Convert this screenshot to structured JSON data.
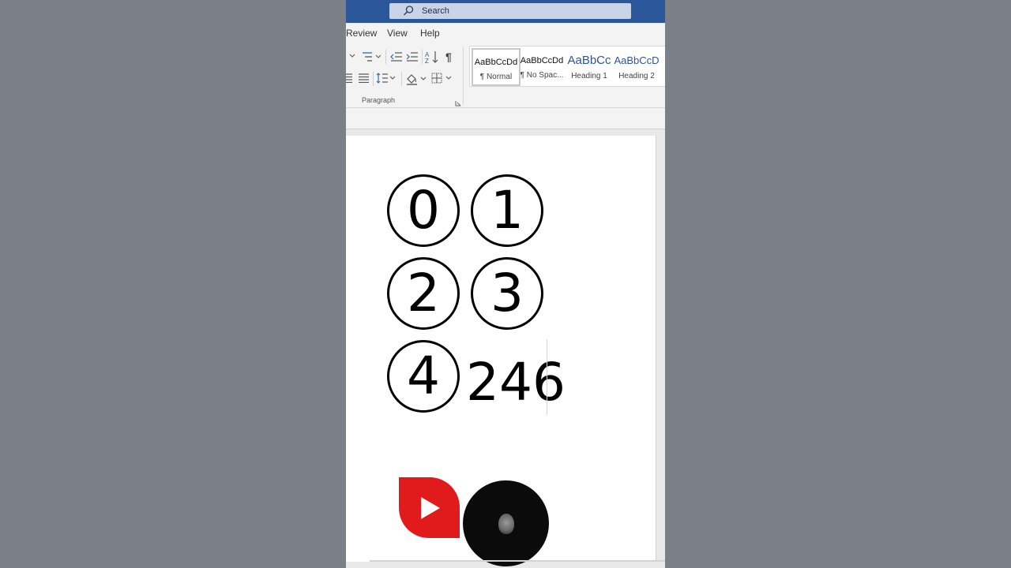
{
  "search": {
    "placeholder": "Search"
  },
  "tabs": [
    {
      "label": "Review"
    },
    {
      "label": "View"
    },
    {
      "label": "Help"
    }
  ],
  "ribbon": {
    "paragraph_group_label": "Paragraph",
    "pilcrow_glyph": "¶",
    "styles": [
      {
        "preview": "AaBbCcDd",
        "name": "¶ Normal"
      },
      {
        "preview": "AaBbCcDd",
        "name": "¶ No Spac..."
      },
      {
        "preview": "AaBbCc",
        "name": "Heading 1"
      },
      {
        "preview": "AaBbCcD",
        "name": "Heading 2"
      }
    ]
  },
  "document": {
    "circled": [
      "0",
      "1",
      "2",
      "3",
      "4"
    ],
    "typed_text": "246"
  },
  "colors": {
    "titlebar": "#2b579a",
    "youtube_red": "#e11b1b"
  }
}
